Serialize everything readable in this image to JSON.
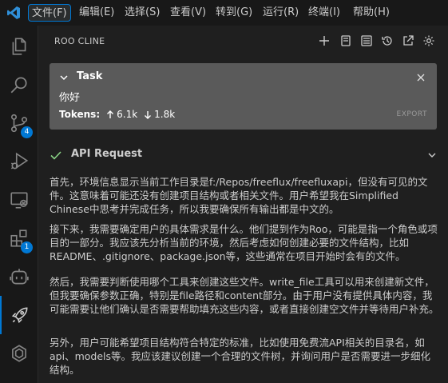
{
  "menu": [
    "文件(F)",
    "编辑(E)",
    "选择(S)",
    "查看(V)",
    "转到(G)",
    "运行(R)",
    "终端(I)",
    "帮助(H)"
  ],
  "active_menu": "文件(F)",
  "activity_badges": {
    "source_control": "4",
    "extensions": "1"
  },
  "panel": {
    "title": "ROO CLINE"
  },
  "task": {
    "label": "Task",
    "text": "你好",
    "tokens_label": "Tokens:",
    "tokens_in": "6.1k",
    "tokens_out": "1.8k",
    "export_label": "EXPORT"
  },
  "api_request": {
    "label": "API Request"
  },
  "paragraphs": [
    "首先，环境信息显示当前工作目录是f:/Repos/freeflux/freefluxapi，但没有可见的文件。这意味着可能还没有创建项目结构或者相关文件。用户希望我在Simplified Chinese中思考并完成任务，所以我要确保所有输出都是中文的。",
    "接下来，我需要确定用户的具体需求是什么。他们提到作为Roo，可能是指一个角色或项目的一部分。我应该先分析当前的环境，然后考虑如何创建必要的文件结构，比如README、.gitignore、package.json等，这些通常在项目开始时会有的文件。",
    "然后，我需要判断使用哪个工具来创建这些文件。write_file工具可以用来创建新文件，但我要确保参数正确，特别是file路径和content部分。由于用户没有提供具体内容，我可能需要让他们确认是否需要帮助填充这些内容，或者直接创建空文件并等待用户补充。",
    "另外，用户可能希望项目结构符合特定的标准，比如使用免费流API相关的目录名，如api、models等。我应该建议创建一个合理的文件树，并询问用户是否需要进一步细化结构。"
  ],
  "colors": {
    "accent": "#0078d4",
    "success": "#89d185",
    "task_bg": "#5a5a5a"
  }
}
